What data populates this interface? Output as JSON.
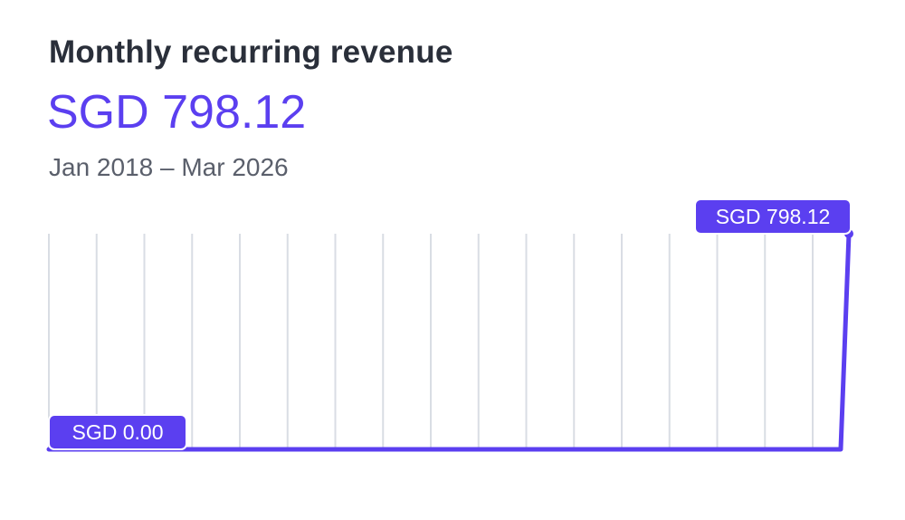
{
  "header": {
    "title": "Monthly recurring revenue",
    "current_value": "SGD 798.12",
    "date_range": "Jan 2018 – Mar 2026"
  },
  "colors": {
    "accent": "#5b3ff0",
    "gridline": "#d9dde4",
    "title": "#2a2f3a",
    "subtitle": "#5a5f6b"
  },
  "chart_data": {
    "type": "line",
    "x_start": "2018-01",
    "x_end": "2026-03",
    "gridlines": 17,
    "points": [
      {
        "x": "2018-01",
        "y": 0.0
      },
      {
        "x": "2026-02",
        "y": 0.0
      },
      {
        "x": "2026-03",
        "y": 798.12
      }
    ],
    "min_label": "SGD 0.00",
    "max_label": "SGD 798.12",
    "ylim": [
      0,
      798.12
    ]
  }
}
